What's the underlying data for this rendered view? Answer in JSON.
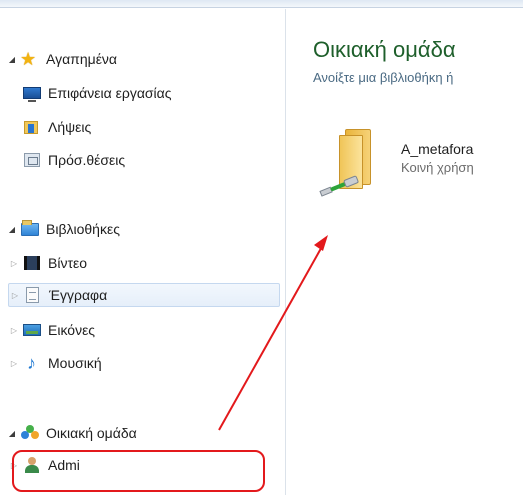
{
  "navigation": {
    "favorites": {
      "label": "Αγαπημένα",
      "items": [
        {
          "label": "Επιφάνεια εργασίας",
          "icon": "desktop-icon"
        },
        {
          "label": "Λήψεις",
          "icon": "downloads-icon"
        },
        {
          "label": "Πρόσ.θέσεις",
          "icon": "recent-places-icon"
        }
      ]
    },
    "libraries": {
      "label": "Βιβλιοθήκες",
      "items": [
        {
          "label": "Βίντεο",
          "icon": "videos-icon"
        },
        {
          "label": "Έγγραφα",
          "icon": "documents-icon",
          "selected": true
        },
        {
          "label": "Εικόνες",
          "icon": "pictures-icon"
        },
        {
          "label": "Μουσική",
          "icon": "music-icon"
        }
      ]
    },
    "homegroup": {
      "label": "Οικιακή ομάδα",
      "items": [
        {
          "label": "Admi",
          "label_tail": ")",
          "icon": "user-icon"
        }
      ]
    }
  },
  "content": {
    "title": "Οικιακή ομάδα",
    "subtitle": "Ανοίξτε μια βιβλιοθήκη ή",
    "shared_items": [
      {
        "name": "A_metafora",
        "status": "Κοινή χρήση",
        "icon": "shared-folder-icon"
      }
    ]
  },
  "annotation": {
    "color": "#e3191c"
  }
}
